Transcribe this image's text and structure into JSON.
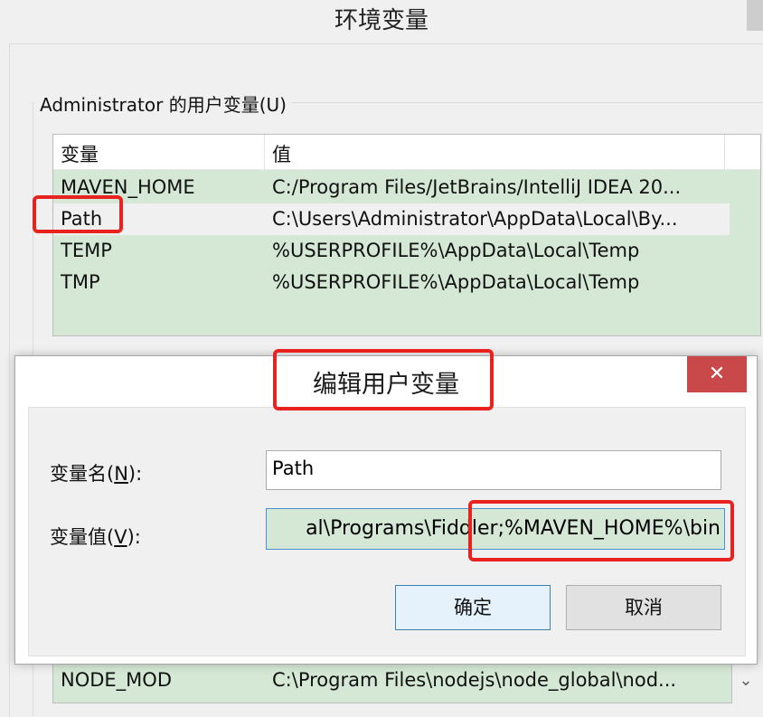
{
  "background_window": {
    "title": "环境变量",
    "user_group_label": "Administrator 的用户变量(U)",
    "columns": {
      "name": "变量",
      "value": "值"
    },
    "user_variables": [
      {
        "name": "MAVEN_HOME",
        "value": "C:/Program Files/JetBrains/IntelliJ IDEA 20..."
      },
      {
        "name": "Path",
        "value": "C:\\Users\\Administrator\\AppData\\Local\\By...",
        "selected": true
      },
      {
        "name": "TEMP",
        "value": "%USERPROFILE%\\AppData\\Local\\Temp"
      },
      {
        "name": "TMP",
        "value": "%USERPROFILE%\\AppData\\Local\\Temp"
      }
    ],
    "system_row": {
      "name": "NODE_MOD",
      "value": "C:\\Program Files\\nodejs\\node_global\\nod..."
    },
    "scroll_down_icon": "chevron-down-icon"
  },
  "dialog": {
    "title": "编辑用户变量",
    "close_icon": "close-icon",
    "name_label_prefix": "变量名(",
    "name_label_key": "N",
    "name_label_suffix": "):",
    "name_value": "Path",
    "value_label_prefix": "变量值(",
    "value_label_key": "V",
    "value_label_suffix": "):",
    "value_visible": "al\\Programs\\Fiddler;%MAVEN_HOME%\\bin",
    "ok_label": "确定",
    "cancel_label": "取消"
  },
  "colors": {
    "list_bg": "#d5e8d5",
    "highlight": "#e8231f",
    "close_button": "#c9494b"
  }
}
